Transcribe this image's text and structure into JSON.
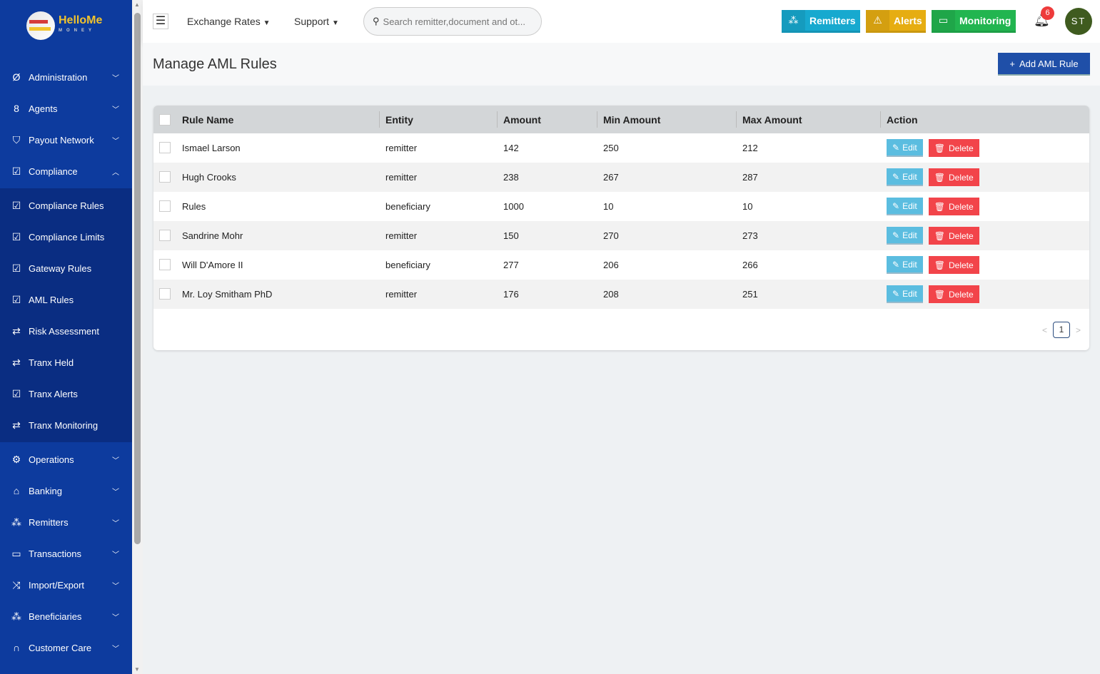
{
  "brand": {
    "name": "HelloMe",
    "sub": "MONEY"
  },
  "sidebar": {
    "items": [
      {
        "label": "Administration",
        "icon": "ring-icon",
        "expandable": true
      },
      {
        "label": "Agents",
        "icon": "user-icon",
        "expandable": true
      },
      {
        "label": "Payout Network",
        "icon": "handshake-icon",
        "expandable": true
      },
      {
        "label": "Compliance",
        "icon": "check-square-icon",
        "expanded": true
      }
    ],
    "submenu": [
      {
        "label": "Compliance Rules",
        "icon": "check-square-icon"
      },
      {
        "label": "Compliance Limits",
        "icon": "check-square-icon"
      },
      {
        "label": "Gateway Rules",
        "icon": "check-square-icon"
      },
      {
        "label": "AML Rules",
        "icon": "check-square-icon"
      },
      {
        "label": "Risk Assessment",
        "icon": "arrows-icon"
      },
      {
        "label": "Tranx Held",
        "icon": "arrows-icon"
      },
      {
        "label": "Tranx Alerts",
        "icon": "check-square-icon"
      },
      {
        "label": "Tranx Monitoring",
        "icon": "arrows-icon"
      }
    ],
    "items_after": [
      {
        "label": "Operations",
        "icon": "gear-icon"
      },
      {
        "label": "Banking",
        "icon": "bank-icon"
      },
      {
        "label": "Remitters",
        "icon": "people-icon"
      },
      {
        "label": "Transactions",
        "icon": "receipt-icon"
      },
      {
        "label": "Import/Export",
        "icon": "shuffle-icon"
      },
      {
        "label": "Beneficiaries",
        "icon": "people-icon"
      },
      {
        "label": "Customer Care",
        "icon": "headset-icon"
      }
    ]
  },
  "topbar": {
    "exchange_rates": "Exchange Rates",
    "support": "Support",
    "search_placeholder": "Search remitter,document and ot...",
    "remitters": "Remitters",
    "alerts": "Alerts",
    "monitoring": "Monitoring",
    "notifications": "6",
    "avatar": "ST",
    "colors": {
      "remitters": "#17a9cf",
      "alerts": "#e6ad12",
      "monitoring": "#22b550"
    }
  },
  "page": {
    "title": "Manage AML Rules",
    "add_button": "Add AML Rule"
  },
  "table": {
    "headers": [
      "Rule Name",
      "Entity",
      "Amount",
      "Min Amount",
      "Max Amount",
      "Action"
    ],
    "rows": [
      [
        "Ismael Larson",
        "remitter",
        "142",
        "250",
        "212"
      ],
      [
        "Hugh Crooks",
        "remitter",
        "238",
        "267",
        "287"
      ],
      [
        "Rules",
        "beneficiary",
        "1000",
        "10",
        "10"
      ],
      [
        "Sandrine Mohr",
        "remitter",
        "150",
        "270",
        "273"
      ],
      [
        "Will D'Amore II",
        "beneficiary",
        "277",
        "206",
        "266"
      ],
      [
        "Mr. Loy Smitham PhD",
        "remitter",
        "176",
        "208",
        "251"
      ]
    ],
    "edit": "Edit",
    "delete": "Delete"
  },
  "pagination": {
    "current": "1"
  }
}
